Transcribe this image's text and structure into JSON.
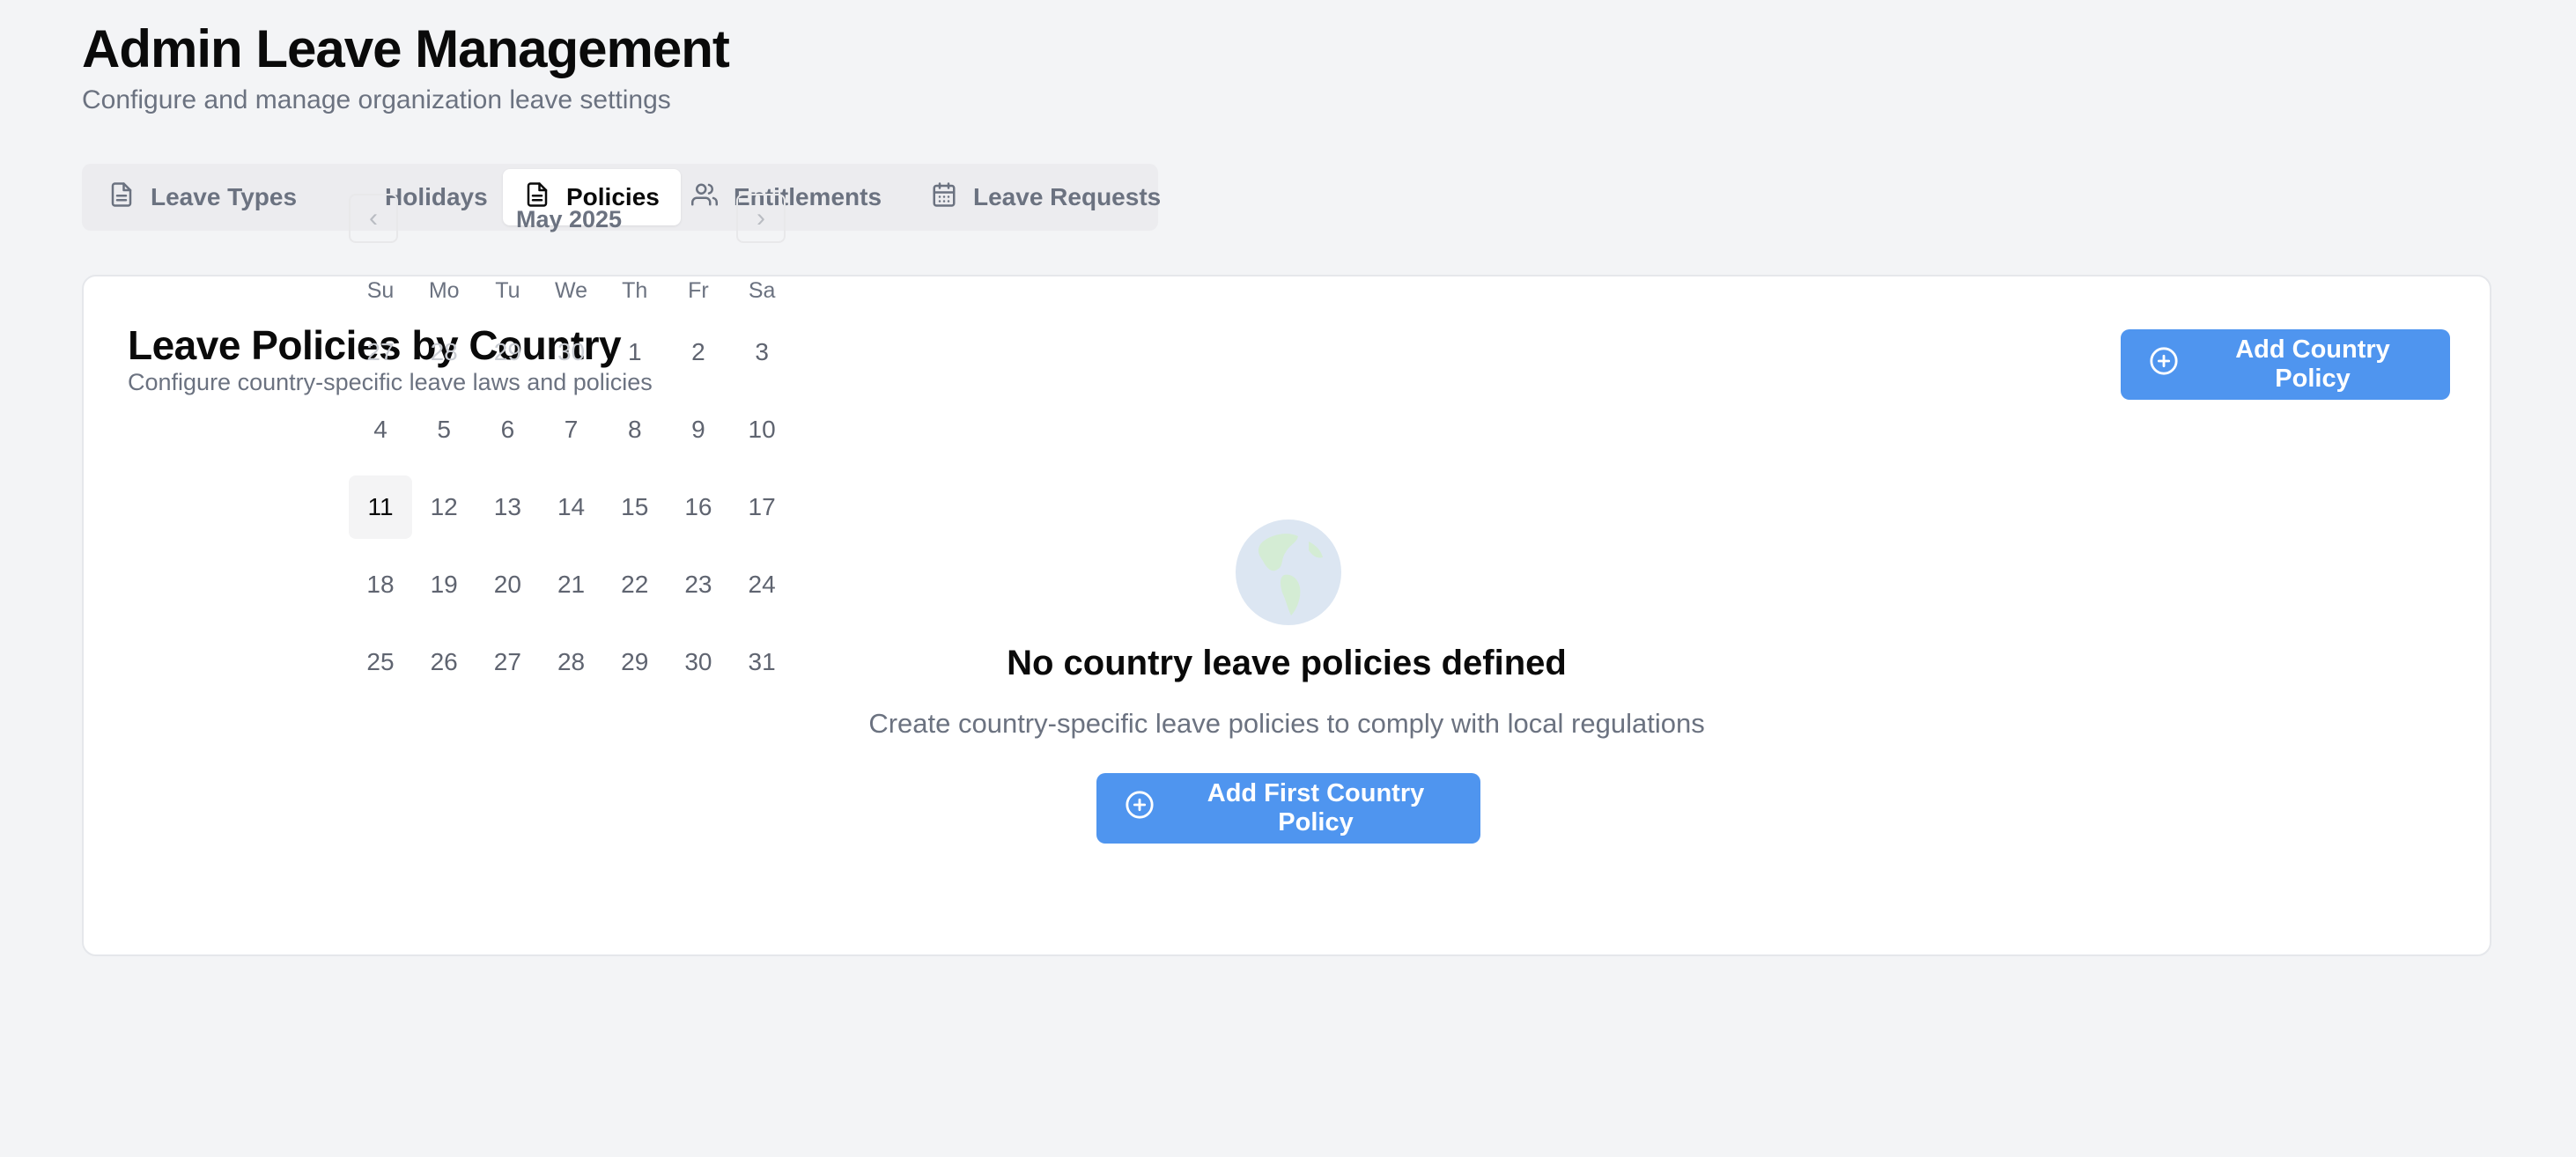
{
  "header": {
    "title": "Admin Leave Management",
    "subtitle": "Configure and manage organization leave settings"
  },
  "tabs": [
    {
      "label": "Leave Types",
      "icon": "file-text-icon",
      "active": false
    },
    {
      "label": "Holidays",
      "icon": "calendar-icon",
      "active": false
    },
    {
      "label": "Policies",
      "icon": "file-text-icon",
      "active": true
    },
    {
      "label": "Entitlements",
      "icon": "users-icon",
      "active": false
    },
    {
      "label": "Leave Requests",
      "icon": "calendar-icon",
      "active": false
    }
  ],
  "card": {
    "title": "Leave Policies by Country",
    "subtitle": "Configure country-specific leave laws and policies",
    "add_button_label": "Add Country Policy",
    "empty_state": {
      "icon": "globe-icon",
      "title": "No country leave policies defined",
      "description": "Create country-specific leave policies to comply with local regulations",
      "button_label": "Add First Country Policy"
    }
  },
  "calendar": {
    "month_label": "May 2025",
    "weekdays": [
      "Su",
      "Mo",
      "Tu",
      "We",
      "Th",
      "Fr",
      "Sa"
    ],
    "weeks": [
      [
        "27",
        "28",
        "29",
        "30",
        "1",
        "2",
        "3"
      ],
      [
        "4",
        "5",
        "6",
        "7",
        "8",
        "9",
        "10"
      ],
      [
        "11",
        "12",
        "13",
        "14",
        "15",
        "16",
        "17"
      ],
      [
        "18",
        "19",
        "20",
        "21",
        "22",
        "23",
        "24"
      ],
      [
        "25",
        "26",
        "27",
        "28",
        "29",
        "30",
        "31"
      ]
    ],
    "today": "11"
  },
  "colors": {
    "primary": "#4f95ef",
    "background": "#f3f4f6",
    "muted_text": "#6b7280"
  }
}
